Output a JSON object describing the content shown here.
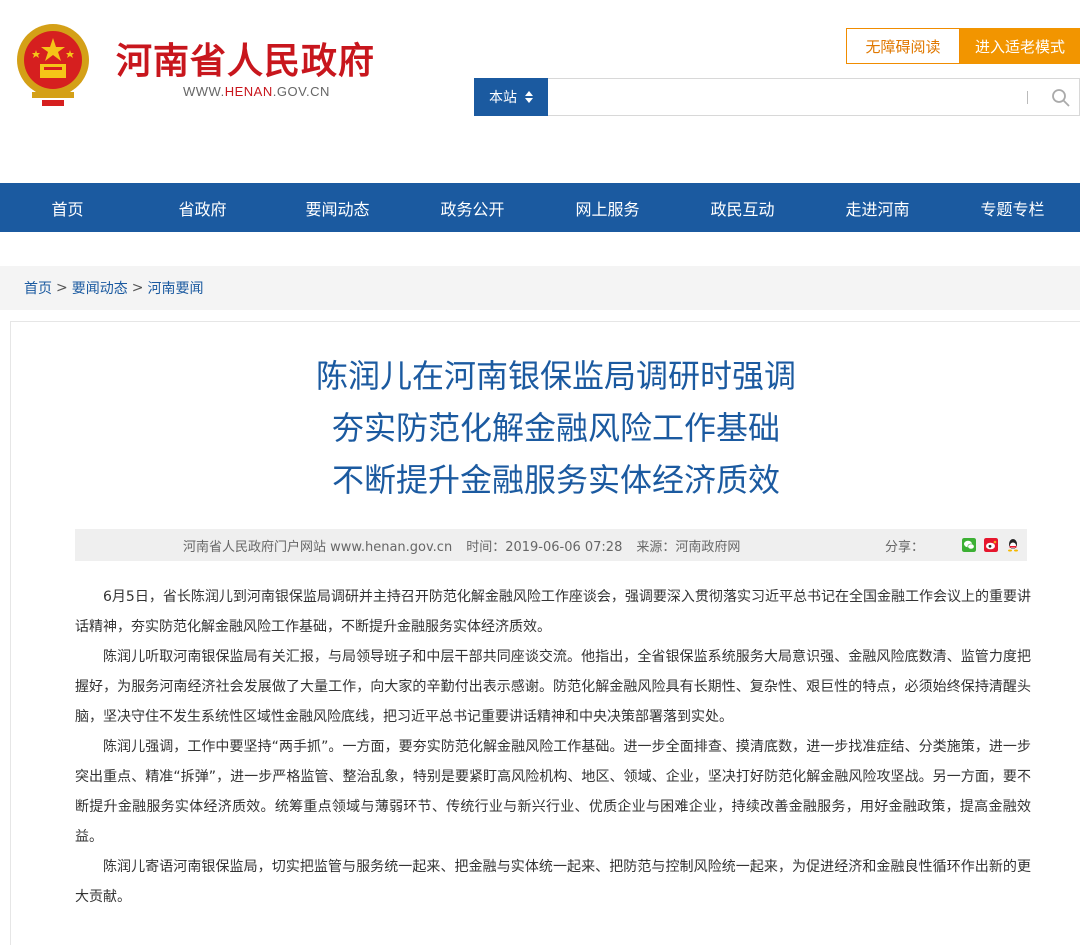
{
  "header": {
    "site_title": "河南省人民政府",
    "site_url_prefix": "WWW.",
    "site_url_brand": "HENAN",
    "site_url_suffix": ".GOV.CN",
    "btn_accessibility": "无障碍阅读",
    "btn_elder_mode": "进入适老模式",
    "search_scope": "本站",
    "search_placeholder": ""
  },
  "nav": {
    "items": [
      "首页",
      "省政府",
      "要闻动态",
      "政务公开",
      "网上服务",
      "政民互动",
      "走进河南",
      "专题专栏"
    ]
  },
  "breadcrumb": {
    "items": [
      "首页",
      "要闻动态",
      "河南要闻"
    ],
    "separator": ">"
  },
  "article": {
    "title_lines": [
      "陈润儿在河南银保监局调研时强调",
      "夯实防范化解金融风险工作基础",
      "不断提升金融服务实体经济质效"
    ],
    "meta": {
      "site": "河南省人民政府门户网站 www.henan.gov.cn",
      "time": "时间：2019-06-06 07:28",
      "source": "来源：河南政府网",
      "share_label": "分享："
    },
    "paragraphs": [
      "6月5日，省长陈润儿到河南银保监局调研并主持召开防范化解金融风险工作座谈会，强调要深入贯彻落实习近平总书记在全国金融工作会议上的重要讲话精神，夯实防范化解金融风险工作基础，不断提升金融服务实体经济质效。",
      "陈润儿听取河南银保监局有关汇报，与局领导班子和中层干部共同座谈交流。他指出，全省银保监系统服务大局意识强、金融风险底数清、监管力度把握好，为服务河南经济社会发展做了大量工作，向大家的辛勤付出表示感谢。防范化解金融风险具有长期性、复杂性、艰巨性的特点，必须始终保持清醒头脑，坚决守住不发生系统性区域性金融风险底线，把习近平总书记重要讲话精神和中央决策部署落到实处。",
      "陈润儿强调，工作中要坚持“两手抓”。一方面，要夯实防范化解金融风险工作基础。进一步全面排查、摸清底数，进一步找准症结、分类施策，进一步突出重点、精准“拆弹”，进一步严格监管、整治乱象，特别是要紧盯高风险机构、地区、领域、企业，坚决打好防范化解金融风险攻坚战。另一方面，要不断提升金融服务实体经济质效。统筹重点领域与薄弱环节、传统行业与新兴行业、优质企业与困难企业，持续改善金融服务，用好金融政策，提高金融效益。",
      "陈润儿寄语河南银保监局，切实把监管与服务统一起来、把金融与实体统一起来、把防范与控制风险统一起来，为促进经济和金融良性循环作出新的更大贡献。"
    ]
  },
  "colors": {
    "brand_red": "#c8161d",
    "nav_blue": "#1b5aa0",
    "accent_orange": "#f29500"
  },
  "icons": {
    "emblem": "national-emblem-icon",
    "search": "search-icon",
    "share": [
      "wechat-icon",
      "weibo-icon",
      "qq-icon"
    ]
  }
}
